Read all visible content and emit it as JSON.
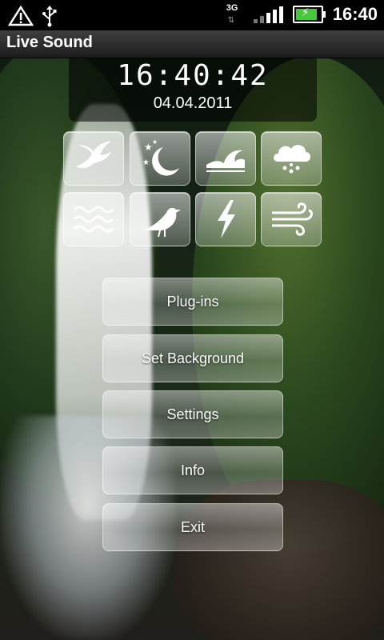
{
  "status_bar": {
    "network_type": "3G",
    "time": "16:40",
    "icons": [
      "alert-icon",
      "usb-icon",
      "signal-icon",
      "battery-charging-icon"
    ]
  },
  "app": {
    "title": "Live Sound"
  },
  "clock": {
    "time": "16:40:42",
    "date": "04.04.2011"
  },
  "sounds": [
    {
      "name": "bird-flying-icon"
    },
    {
      "name": "night-icon"
    },
    {
      "name": "waves-icon"
    },
    {
      "name": "rain-icon"
    },
    {
      "name": "water-icon"
    },
    {
      "name": "songbird-icon"
    },
    {
      "name": "thunder-icon"
    },
    {
      "name": "wind-icon"
    }
  ],
  "menu": {
    "plugins": "Plug-ins",
    "set_background": "Set Background",
    "settings": "Settings",
    "info": "Info",
    "exit": "Exit"
  }
}
